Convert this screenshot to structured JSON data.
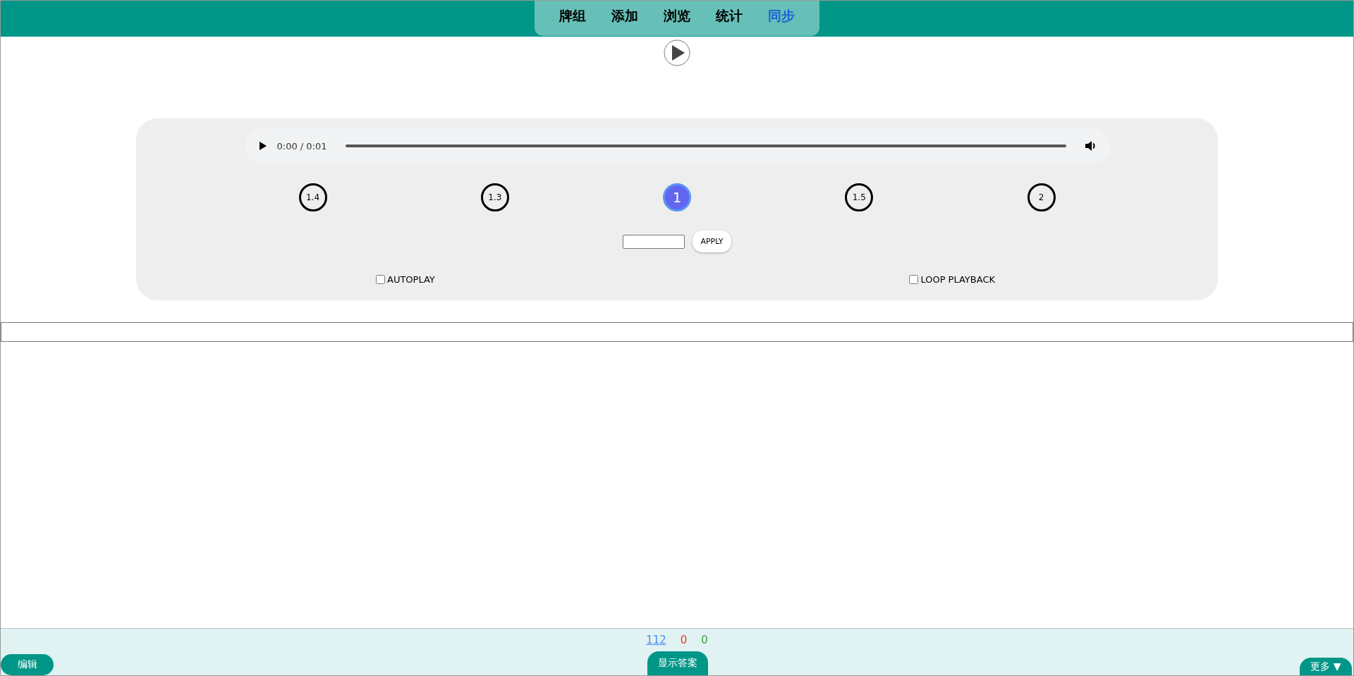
{
  "nav": {
    "tabs": [
      {
        "label": "牌组",
        "selected": false
      },
      {
        "label": "添加",
        "selected": false
      },
      {
        "label": "浏览",
        "selected": false
      },
      {
        "label": "统计",
        "selected": false
      },
      {
        "label": "同步",
        "selected": true
      }
    ]
  },
  "player": {
    "time": "0:00 / 0:01"
  },
  "speeds": [
    {
      "label": "1.4",
      "selected": false
    },
    {
      "label": "1.3",
      "selected": false
    },
    {
      "label": "1",
      "selected": true
    },
    {
      "label": "1.5",
      "selected": false
    },
    {
      "label": "2",
      "selected": false
    }
  ],
  "apply_button": "APPLY",
  "options": [
    {
      "label": "AUTOPLAY",
      "checked": false
    },
    {
      "label": "LOOP PLAYBACK",
      "checked": false
    }
  ],
  "counts": [
    {
      "value": "112",
      "kind": "link"
    },
    {
      "value": "0",
      "kind": "red"
    },
    {
      "value": "0",
      "kind": "green"
    }
  ],
  "bottom": {
    "edit": "编辑",
    "show_answer": "显示答案",
    "more": "更多 ▼"
  }
}
